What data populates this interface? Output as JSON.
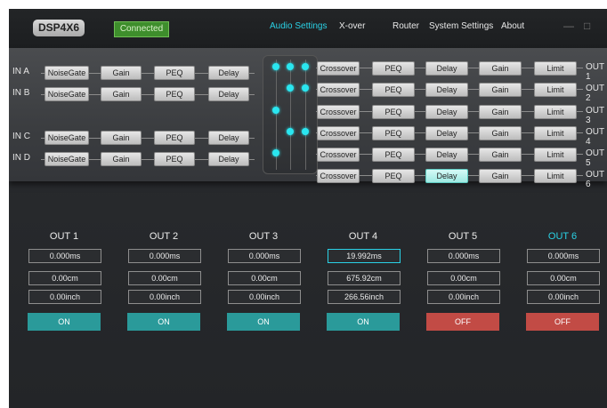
{
  "header": {
    "logo": "DSP4X6",
    "status": "Connected",
    "nav": [
      "Audio Settings",
      "X-over",
      "Router",
      "System Settings",
      "About"
    ],
    "active_nav": "Audio Settings",
    "min_icon": "—",
    "max_icon": "□"
  },
  "inputs": [
    {
      "label": "IN A",
      "blocks": [
        "NoiseGate",
        "Gain",
        "PEQ",
        "Delay"
      ]
    },
    {
      "label": "IN B",
      "blocks": [
        "NoiseGate",
        "Gain",
        "PEQ",
        "Delay"
      ]
    },
    {
      "label": "IN C",
      "blocks": [
        "NoiseGate",
        "Gain",
        "PEQ",
        "Delay"
      ]
    },
    {
      "label": "IN D",
      "blocks": [
        "NoiseGate",
        "Gain",
        "PEQ",
        "Delay"
      ]
    }
  ],
  "outputs_chain": [
    {
      "label": "OUT 1",
      "blocks": [
        "Crossover",
        "PEQ",
        "Delay",
        "Gain",
        "Limit"
      ]
    },
    {
      "label": "OUT 2",
      "blocks": [
        "Crossover",
        "PEQ",
        "Delay",
        "Gain",
        "Limit"
      ]
    },
    {
      "label": "OUT 3",
      "blocks": [
        "Crossover",
        "PEQ",
        "Delay",
        "Gain",
        "Limit"
      ]
    },
    {
      "label": "OUT 4",
      "blocks": [
        "Crossover",
        "PEQ",
        "Delay",
        "Gain",
        "Limit"
      ]
    },
    {
      "label": "OUT 5",
      "blocks": [
        "Crossover",
        "PEQ",
        "Delay",
        "Gain",
        "Limit"
      ]
    },
    {
      "label": "OUT 6",
      "blocks": [
        "Crossover",
        "PEQ",
        "Delay",
        "Gain",
        "Limit"
      ]
    }
  ],
  "delay_panel": [
    {
      "title": "OUT 1",
      "ms": "0.000ms",
      "cm": "0.00cm",
      "inch": "0.00inch",
      "state": "ON"
    },
    {
      "title": "OUT 2",
      "ms": "0.000ms",
      "cm": "0.00cm",
      "inch": "0.00inch",
      "state": "ON"
    },
    {
      "title": "OUT 3",
      "ms": "0.000ms",
      "cm": "0.00cm",
      "inch": "0.00inch",
      "state": "ON"
    },
    {
      "title": "OUT 4",
      "ms": "19.992ms",
      "cm": "675.92cm",
      "inch": "266.56inch",
      "state": "ON"
    },
    {
      "title": "OUT 5",
      "ms": "0.000ms",
      "cm": "0.00cm",
      "inch": "0.00inch",
      "state": "OFF"
    },
    {
      "title": "OUT 6",
      "ms": "0.000ms",
      "cm": "0.00cm",
      "inch": "0.00inch",
      "state": "OFF"
    }
  ],
  "colors": {
    "accent": "#2ad2e6",
    "on": "#2a9a9a",
    "off": "#c24b45",
    "connected": "#3e8e2c"
  }
}
